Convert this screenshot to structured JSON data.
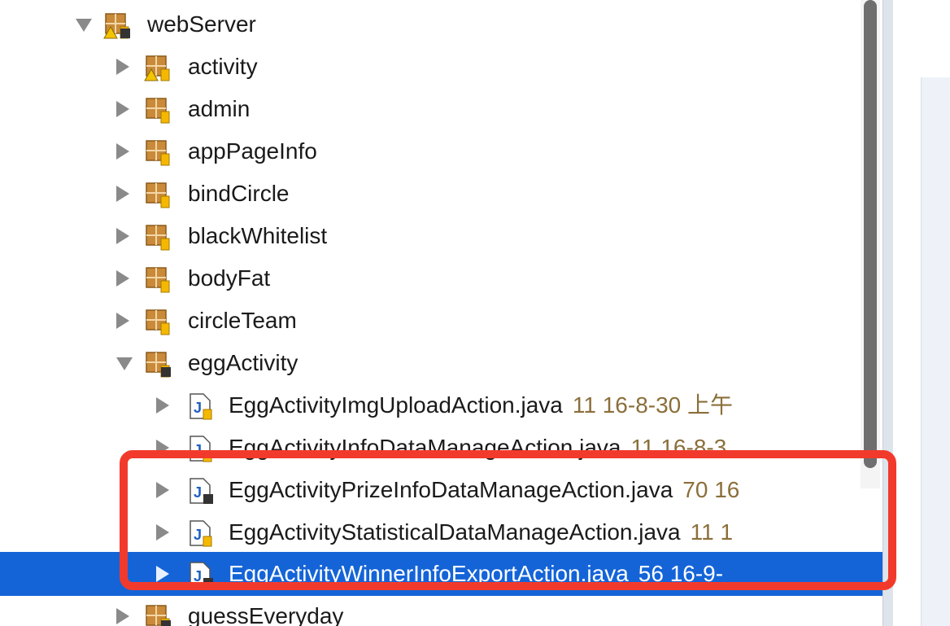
{
  "tree": {
    "root": {
      "label": "webServer"
    },
    "packages": [
      {
        "label": "activity"
      },
      {
        "label": "admin"
      },
      {
        "label": "appPageInfo"
      },
      {
        "label": "bindCircle"
      },
      {
        "label": "blackWhitelist"
      },
      {
        "label": "bodyFat"
      },
      {
        "label": "circleTeam"
      },
      {
        "label": "eggActivity"
      }
    ],
    "files": [
      {
        "name": "EggActivityImgUploadAction.java",
        "meta": "11  16-8-30 上午"
      },
      {
        "name": "EggActivityInfoDataManageAction.java",
        "meta": "11  16-8-3"
      },
      {
        "name": "EggActivityPrizeInfoDataManageAction.java",
        "meta": "70  16"
      },
      {
        "name": "EggActivityStatisticalDataManageAction.java",
        "meta": "11  1"
      },
      {
        "name": "EggActivityWinnerInfoExportAction.java",
        "meta": "56  16-9-"
      }
    ],
    "next_package": {
      "label": "guessEveryday"
    }
  },
  "colors": {
    "selection": "#1464d8",
    "highlight_border": "#f23a2c",
    "meta_text": "#8b6f3a"
  },
  "icons": {
    "project": "project-warning-icon",
    "package": "package-icon",
    "java_file": "java-file-icon"
  }
}
